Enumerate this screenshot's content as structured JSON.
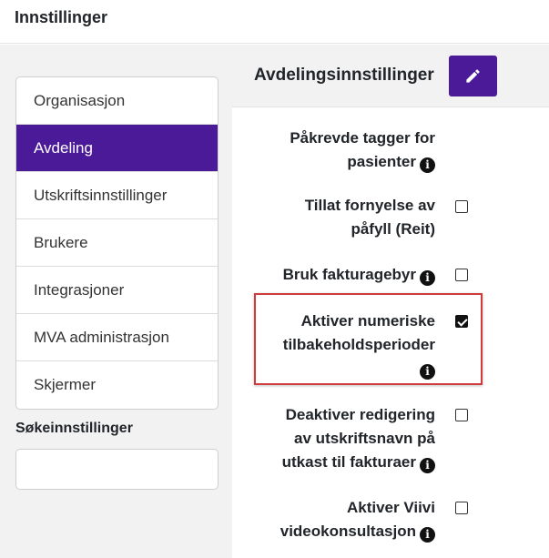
{
  "header": {
    "title": "Innstillinger"
  },
  "sidebar": {
    "items": [
      {
        "label": "Organisasjon"
      },
      {
        "label": "Avdeling"
      },
      {
        "label": "Utskriftsinnstillinger"
      },
      {
        "label": "Brukere"
      },
      {
        "label": "Integrasjoner"
      },
      {
        "label": "MVA administrasjon"
      },
      {
        "label": "Skjermer"
      }
    ],
    "active_index": 1,
    "search": {
      "label": "Søkeinnstillinger",
      "value": ""
    }
  },
  "main": {
    "title": "Avdelingsinnstillinger",
    "edit_icon": "pencil-icon",
    "settings": [
      {
        "line1": "Påkrevde tagger for",
        "line2": "pasienter",
        "has_info": true,
        "has_checkbox": false
      },
      {
        "line1": "Tillat fornyelse av",
        "line2": "påfyll (Reit)",
        "has_info": false,
        "has_checkbox": true,
        "checked": false
      },
      {
        "line1": "Bruk fakturagebyr",
        "has_info": true,
        "has_checkbox": true,
        "checked": false
      },
      {
        "line1": "Aktiver numeriske",
        "line2": "tilbakeholdsperioder",
        "has_info": true,
        "has_checkbox": true,
        "checked": true,
        "highlighted": true
      },
      {
        "line1": "Deaktiver redigering",
        "line2": "av utskriftsnavn på",
        "line3": "utkast til fakturaer",
        "has_info": true,
        "has_checkbox": true,
        "checked": false
      },
      {
        "line1": "Aktiver Viivi",
        "line2": "videokonsultasjon",
        "has_info": true,
        "has_checkbox": true,
        "checked": false
      }
    ]
  },
  "colors": {
    "accent": "#4a1a99",
    "highlight": "#d03a3a",
    "panel_bg": "#f2f2f2"
  },
  "info_glyph": "i"
}
